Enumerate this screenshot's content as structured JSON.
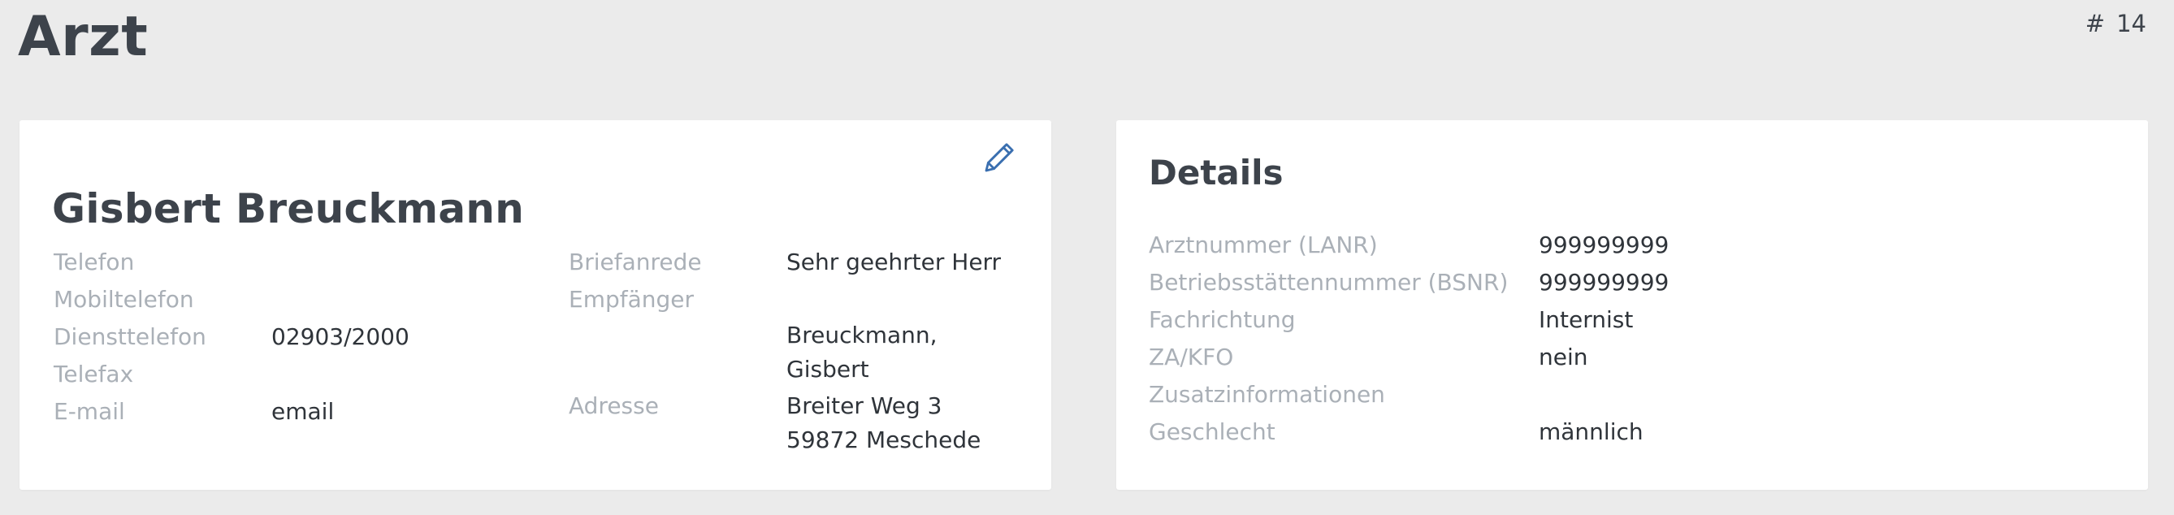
{
  "page": {
    "title": "Arzt",
    "id_symbol": "#",
    "id_value": "14"
  },
  "contact_card": {
    "name": "Gisbert Breuckmann",
    "edit_icon": "pencil-icon",
    "left_fields": [
      {
        "label": "Telefon",
        "value": ""
      },
      {
        "label": "Mobiltelefon",
        "value": ""
      },
      {
        "label": "Diensttelefon",
        "value": "02903/2000"
      },
      {
        "label": "Telefax",
        "value": ""
      },
      {
        "label": "E-mail",
        "value": "email"
      }
    ],
    "right_fields": [
      {
        "label": "Briefanrede",
        "value": "Sehr geehrter Herr"
      },
      {
        "label": "Empfänger",
        "value": ""
      },
      {
        "label": "",
        "value": "Breuckmann,\nGisbert"
      },
      {
        "label": "Adresse",
        "value": "Breiter Weg 3\n59872 Meschede"
      }
    ]
  },
  "details_card": {
    "title": "Details",
    "fields": [
      {
        "label": "Arztnummer (LANR)",
        "value": "999999999"
      },
      {
        "label": "Betriebsstättennummer (BSNR)",
        "value": "999999999"
      },
      {
        "label": "Fachrichtung",
        "value": "Internist"
      },
      {
        "label": "ZA/KFO",
        "value": "nein"
      },
      {
        "label": "Zusatzinformationen",
        "value": ""
      },
      {
        "label": "Geschlecht",
        "value": "männlich"
      }
    ]
  },
  "colors": {
    "background": "#ebebeb",
    "card": "#ffffff",
    "heading": "#3d434b",
    "label": "#aab0b7",
    "value": "#2f343a",
    "accent": "#3a6fb0"
  }
}
